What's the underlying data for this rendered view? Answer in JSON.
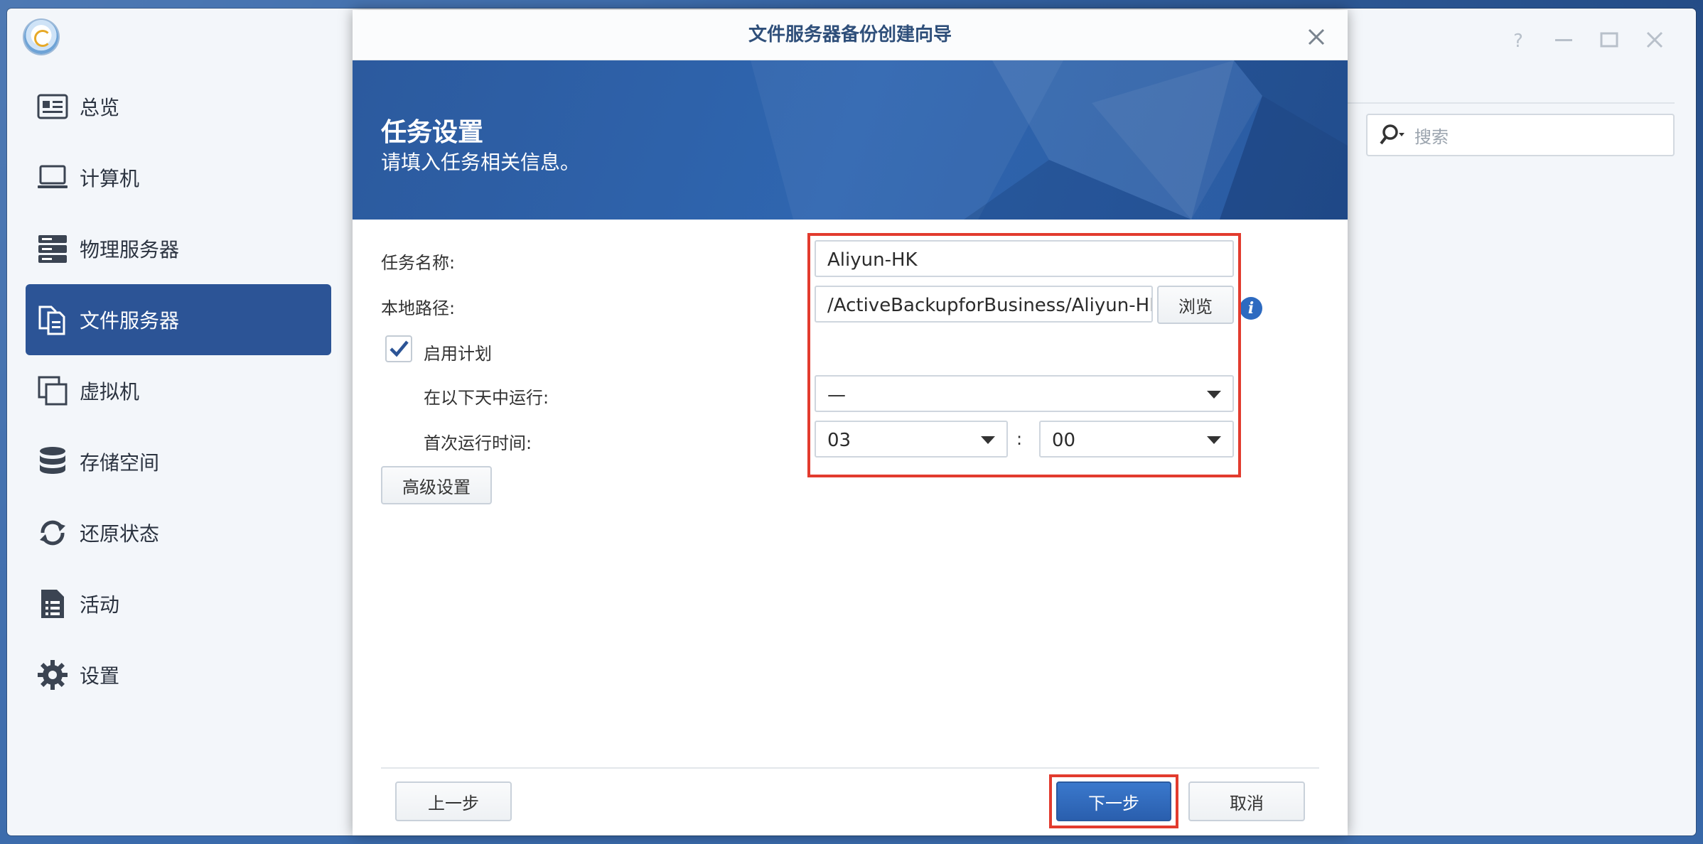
{
  "window": {
    "title": "文件服务器备份创建向导",
    "controls": [
      "help-icon",
      "minimize-icon",
      "maximize-icon",
      "close-icon"
    ]
  },
  "sidebar": {
    "items": [
      {
        "label": "总览",
        "icon": "overview-card-icon",
        "active": false
      },
      {
        "label": "计算机",
        "icon": "laptop-icon",
        "active": false
      },
      {
        "label": "物理服务器",
        "icon": "server-rack-icon",
        "active": false
      },
      {
        "label": "文件服务器",
        "icon": "file-server-icon",
        "active": true
      },
      {
        "label": "虚拟机",
        "icon": "virtual-machine-icon",
        "active": false
      },
      {
        "label": "存储空间",
        "icon": "database-icon",
        "active": false
      },
      {
        "label": "还原状态",
        "icon": "restore-sync-icon",
        "active": false
      },
      {
        "label": "活动",
        "icon": "activity-list-icon",
        "active": false
      },
      {
        "label": "设置",
        "icon": "gear-icon",
        "active": false
      }
    ]
  },
  "search": {
    "placeholder": "搜索"
  },
  "banner": {
    "heading": "任务设置",
    "subheading": "请填入任务相关信息。"
  },
  "form": {
    "task_name_label": "任务名称:",
    "task_name_value": "Aliyun-HK",
    "local_path_label": "本地路径:",
    "local_path_value": "/ActiveBackupforBusiness/Aliyun-HK",
    "browse_label": "浏览",
    "enable_schedule_label": "启用计划",
    "enable_schedule_checked": true,
    "run_days_label": "在以下天中运行:",
    "run_days_value": "—",
    "first_run_label": "首次运行时间:",
    "first_run_hour": "03",
    "time_separator": ":",
    "first_run_minute": "00",
    "advanced_label": "高级设置"
  },
  "footer": {
    "prev_label": "上一步",
    "next_label": "下一步",
    "cancel_label": "取消"
  },
  "colors": {
    "accent": "#2c5496",
    "highlight": "#e23b2e",
    "primary_button": "#2f6ac0"
  }
}
